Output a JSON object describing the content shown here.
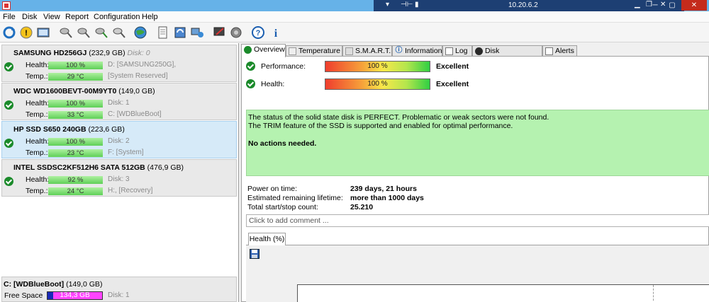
{
  "remote": {
    "ip": "10.20.6.2"
  },
  "menu": [
    "File",
    "Disk",
    "View",
    "Report",
    "Configuration",
    "Help"
  ],
  "disks": [
    {
      "name": "SAMSUNG HD256GJ",
      "size": "(232,9 GB)",
      "disk": "Disk: 0",
      "health_label": "Health:",
      "health": "100 %",
      "health_pct": 100,
      "temp_label": "Temp.:",
      "temp": "29 °C",
      "info1": "D: [SAMSUNG250G],",
      "info2": "[System Reserved]",
      "selected": false
    },
    {
      "name": "WDC WD1600BEVT-00M9YT0",
      "size": "(149,0 GB)",
      "disk": "",
      "health_label": "Health:",
      "health": "100 %",
      "health_pct": 100,
      "temp_label": "Temp.:",
      "temp": "33 °C",
      "info1": "Disk: 1",
      "info2": "C: [WDBlueBoot]",
      "selected": false
    },
    {
      "name": "HP SSD S650 240GB",
      "size": "(223,6 GB)",
      "disk": "",
      "health_label": "Health:",
      "health": "100 %",
      "health_pct": 100,
      "temp_label": "Temp.:",
      "temp": "23 °C",
      "info1": "Disk: 2",
      "info2": "F: [System]",
      "selected": true
    },
    {
      "name": "INTEL SSDSC2KF512H6 SATA 512GB",
      "size": "(476,9 GB)",
      "disk": "",
      "health_label": "Health:",
      "health": "92 %",
      "health_pct": 92,
      "temp_label": "Temp.:",
      "temp": "24 °C",
      "info1": "Disk: 3",
      "info2": "H:, [Recovery]",
      "selected": false
    }
  ],
  "volume": {
    "name": "C: [WDBlueBoot]",
    "size": "(149,0 GB)",
    "free_label": "Free Space",
    "free": "134,3 GB",
    "disk": "Disk: 1",
    "used_fraction": 0.1
  },
  "tabs": [
    "Overview",
    "Temperature",
    "S.M.A.R.T.",
    "Information",
    "Log",
    "Disk Performance",
    "Alerts"
  ],
  "overview": {
    "performance_label": "Performance:",
    "performance": "100 %",
    "performance_grade": "Excellent",
    "health_label": "Health:",
    "health": "100 %",
    "health_grade": "Excellent",
    "message_line1": "The status of the solid state disk is PERFECT. Problematic or weak sectors were not found.",
    "message_line2": "The TRIM feature of the SSD is supported and enabled for optimal performance.",
    "message_actions": "No actions needed.",
    "power_on_label": "Power on time:",
    "power_on": "239 days, 21 hours",
    "lifetime_label": "Estimated remaining lifetime:",
    "lifetime": "more than 1000 days",
    "startstop_label": "Total start/stop count:",
    "startstop": "25.210",
    "comment_placeholder": "Click to add comment ...",
    "subtab": "Health (%)"
  },
  "colors": {
    "titlebar": "#66b2e8",
    "remote_bar": "#1d3f73",
    "selected_disk": "#d6eaf8",
    "message_bg": "#b5f2b0",
    "ok_green": "#1a8a2a"
  }
}
